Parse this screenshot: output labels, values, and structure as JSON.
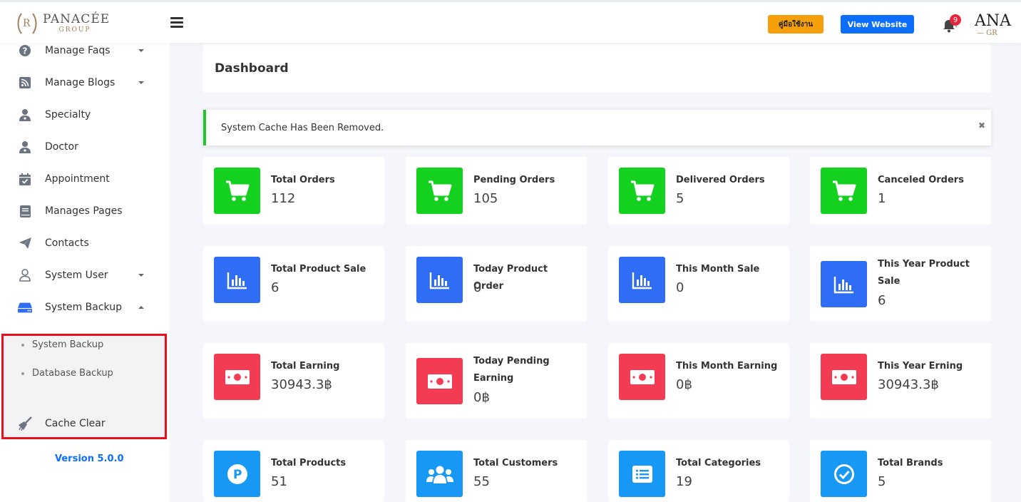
{
  "header": {
    "logo_brand": "PANACÉE",
    "logo_sub": "GROUP",
    "manual_button": "คู่มือใช้งาน",
    "view_website_button": "View Website",
    "notification_count": "9",
    "profile_brand": "ANA",
    "profile_sub": "— GR"
  },
  "sidebar": {
    "items": [
      {
        "label": "Manage Faqs",
        "icon": "question-circle-icon"
      },
      {
        "label": "Manage Blogs",
        "icon": "rss-icon"
      },
      {
        "label": "Specialty",
        "icon": "user-doctor-icon"
      },
      {
        "label": "Doctor",
        "icon": "user-doctor-icon"
      },
      {
        "label": "Appointment",
        "icon": "calendar-check-icon"
      },
      {
        "label": "Manages Pages",
        "icon": "book-icon"
      },
      {
        "label": "Contacts",
        "icon": "paper-plane-icon"
      },
      {
        "label": "System User",
        "icon": "user-icon"
      },
      {
        "label": "System Backup",
        "icon": "hdd-icon"
      }
    ],
    "backup_sub": [
      "System Backup",
      "Database Backup"
    ],
    "cache_clear": "Cache Clear",
    "version": "Version 5.0.0"
  },
  "main": {
    "title": "Dashboard",
    "alert": "System Cache Has Been Removed.",
    "alert_close": "✖",
    "stats": [
      {
        "label": "Total Orders",
        "value": "112",
        "icon": "cart-icon",
        "color": "#14d11f"
      },
      {
        "label": "Pending Orders",
        "value": "105",
        "icon": "cart-icon",
        "color": "#14d11f"
      },
      {
        "label": "Delivered Orders",
        "value": "5",
        "icon": "cart-icon",
        "color": "#14d11f"
      },
      {
        "label": "Canceled Orders",
        "value": "1",
        "icon": "cart-icon",
        "color": "#14d11f"
      },
      {
        "label": "Total Product Sale",
        "value": "6",
        "icon": "bar-chart-icon",
        "color": "#2f6df5"
      },
      {
        "label": "Today Product Order",
        "value": "0",
        "icon": "bar-chart-icon",
        "color": "#2f6df5"
      },
      {
        "label": "This Month Sale",
        "value": "0",
        "icon": "bar-chart-icon",
        "color": "#2f6df5"
      },
      {
        "label": "This Year Product Sale",
        "value": "6",
        "icon": "bar-chart-icon",
        "color": "#2f6df5"
      },
      {
        "label": "Total Earning",
        "value": "30943.3฿",
        "icon": "money-bill-icon",
        "color": "#f43b54"
      },
      {
        "label": "Today Pending Earning",
        "value": "0฿",
        "icon": "money-bill-icon",
        "color": "#f43b54"
      },
      {
        "label": "This Month Earning",
        "value": "0฿",
        "icon": "money-bill-icon",
        "color": "#f43b54"
      },
      {
        "label": "This Year Erning",
        "value": "30943.3฿",
        "icon": "money-bill-icon",
        "color": "#f43b54"
      },
      {
        "label": "Total Products",
        "value": "51",
        "icon": "product-p-icon",
        "color": "#1798f5"
      },
      {
        "label": "Total Customers",
        "value": "55",
        "icon": "users-icon",
        "color": "#1798f5"
      },
      {
        "label": "Total Categories",
        "value": "19",
        "icon": "list-icon",
        "color": "#1798f5"
      },
      {
        "label": "Total Brands",
        "value": "5",
        "icon": "check-circle-icon",
        "color": "#1798f5"
      }
    ]
  }
}
